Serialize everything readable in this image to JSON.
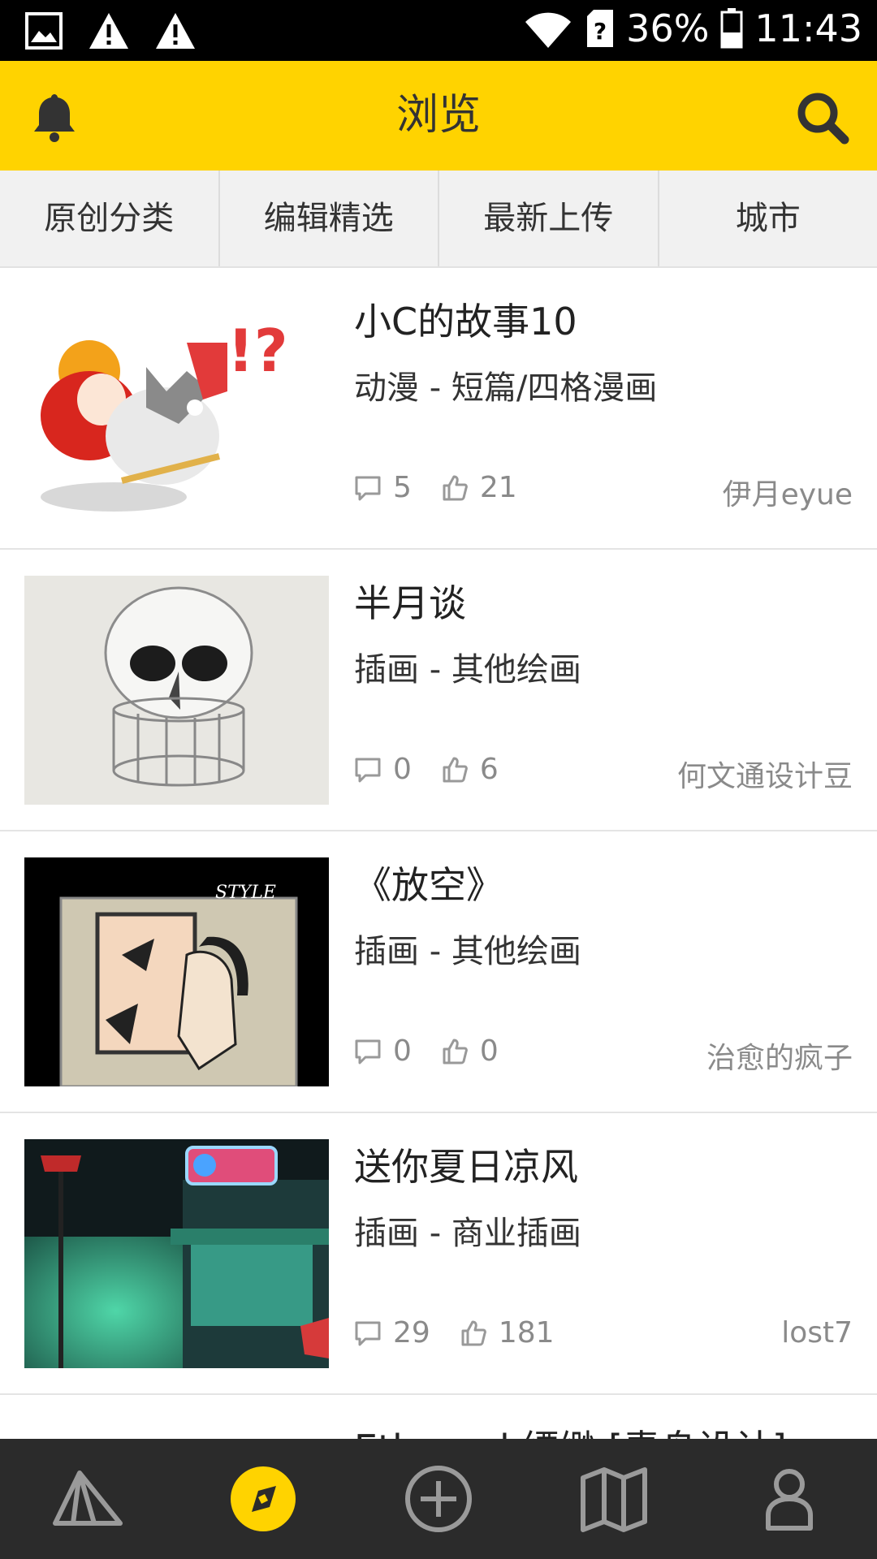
{
  "status_bar": {
    "battery": "36%",
    "time": "11:43",
    "icons": [
      "image-icon",
      "warning-icon",
      "warning-icon",
      "wifi-icon",
      "sim-unknown-icon",
      "battery-icon"
    ]
  },
  "header": {
    "title": "浏览",
    "left_icon": "bell-icon",
    "right_icon": "search-icon",
    "color": "#FFD300"
  },
  "tabs": [
    {
      "label": "原创分类"
    },
    {
      "label": "编辑精选"
    },
    {
      "label": "最新上传"
    },
    {
      "label": "城市"
    }
  ],
  "items": [
    {
      "title": "小C的故事10",
      "category": "动漫 - 短篇/四格漫画",
      "comments": "5",
      "likes": "21",
      "author": "伊月eyue"
    },
    {
      "title": "半月谈",
      "category": "插画 - 其他绘画",
      "comments": "0",
      "likes": "6",
      "author": "何文通设计豆"
    },
    {
      "title": "《放空》",
      "category": "插画 - 其他绘画",
      "comments": "0",
      "likes": "0",
      "author": "治愈的疯子"
    },
    {
      "title": "送你夏日凉风",
      "category": "插画 - 商业插画",
      "comments": "29",
      "likes": "181",
      "author": "lost7"
    },
    {
      "title": "Ethereal 缥缈 [青舟设计]"
    }
  ],
  "bottom_nav": {
    "items": [
      "camp-icon",
      "compass-icon",
      "add-circle-icon",
      "map-icon",
      "person-icon"
    ],
    "active_index": 1,
    "active_color": "#FFD300"
  }
}
